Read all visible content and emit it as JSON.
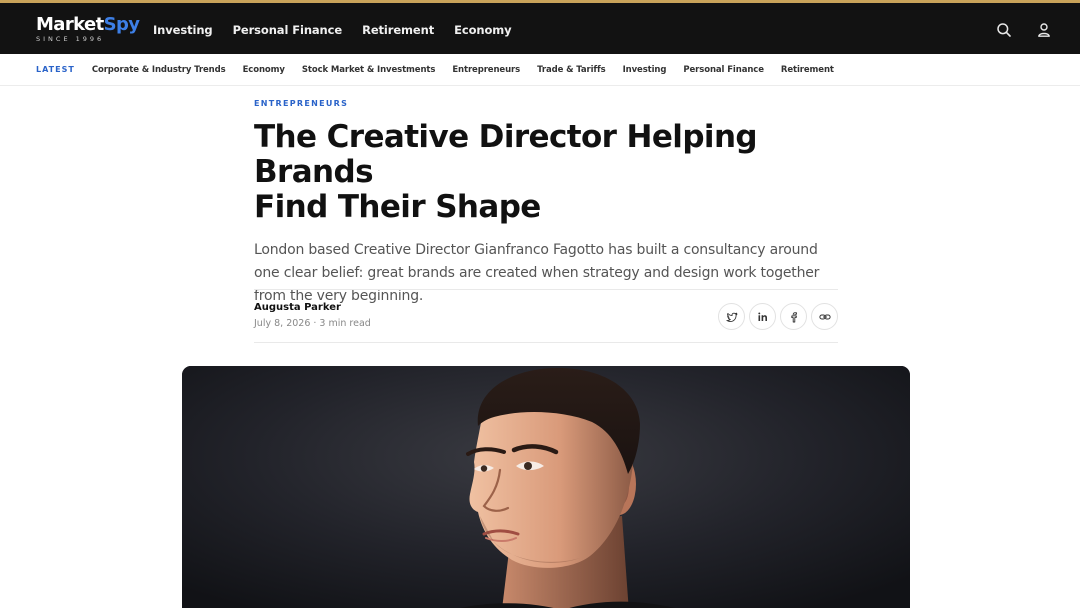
{
  "brand": {
    "name_part1": "Market",
    "name_part2": "Spy",
    "tagline": "SINCE 1996"
  },
  "main_nav": [
    "Investing",
    "Personal Finance",
    "Retirement",
    "Economy"
  ],
  "top_icons": [
    "search-icon",
    "user-icon"
  ],
  "sub_nav": {
    "latest": "LATEST",
    "items": [
      "Corporate & Industry Trends",
      "Economy",
      "Stock Market & Investments",
      "Entrepreneurs",
      "Trade & Tariffs",
      "Investing",
      "Personal Finance",
      "Retirement"
    ]
  },
  "article": {
    "kicker": "ENTREPRENEURS",
    "headline_line1": "The Creative Director Helping Brands",
    "headline_line2": "Find Their Shape",
    "dek": "London based Creative Director Gianfranco Fagotto has built a consultancy around one clear belief: great brands are created when strategy and design work together from the very beginning.",
    "author": "Augusta Parker",
    "meta": "July 8, 2026 · 3 min read"
  },
  "share_icons": [
    "twitter-icon",
    "linkedin-icon",
    "facebook-icon",
    "link-icon"
  ],
  "colors": {
    "accent": "#2a63c9",
    "topbar": "#121212",
    "topbar_border": "#c9a35a"
  }
}
